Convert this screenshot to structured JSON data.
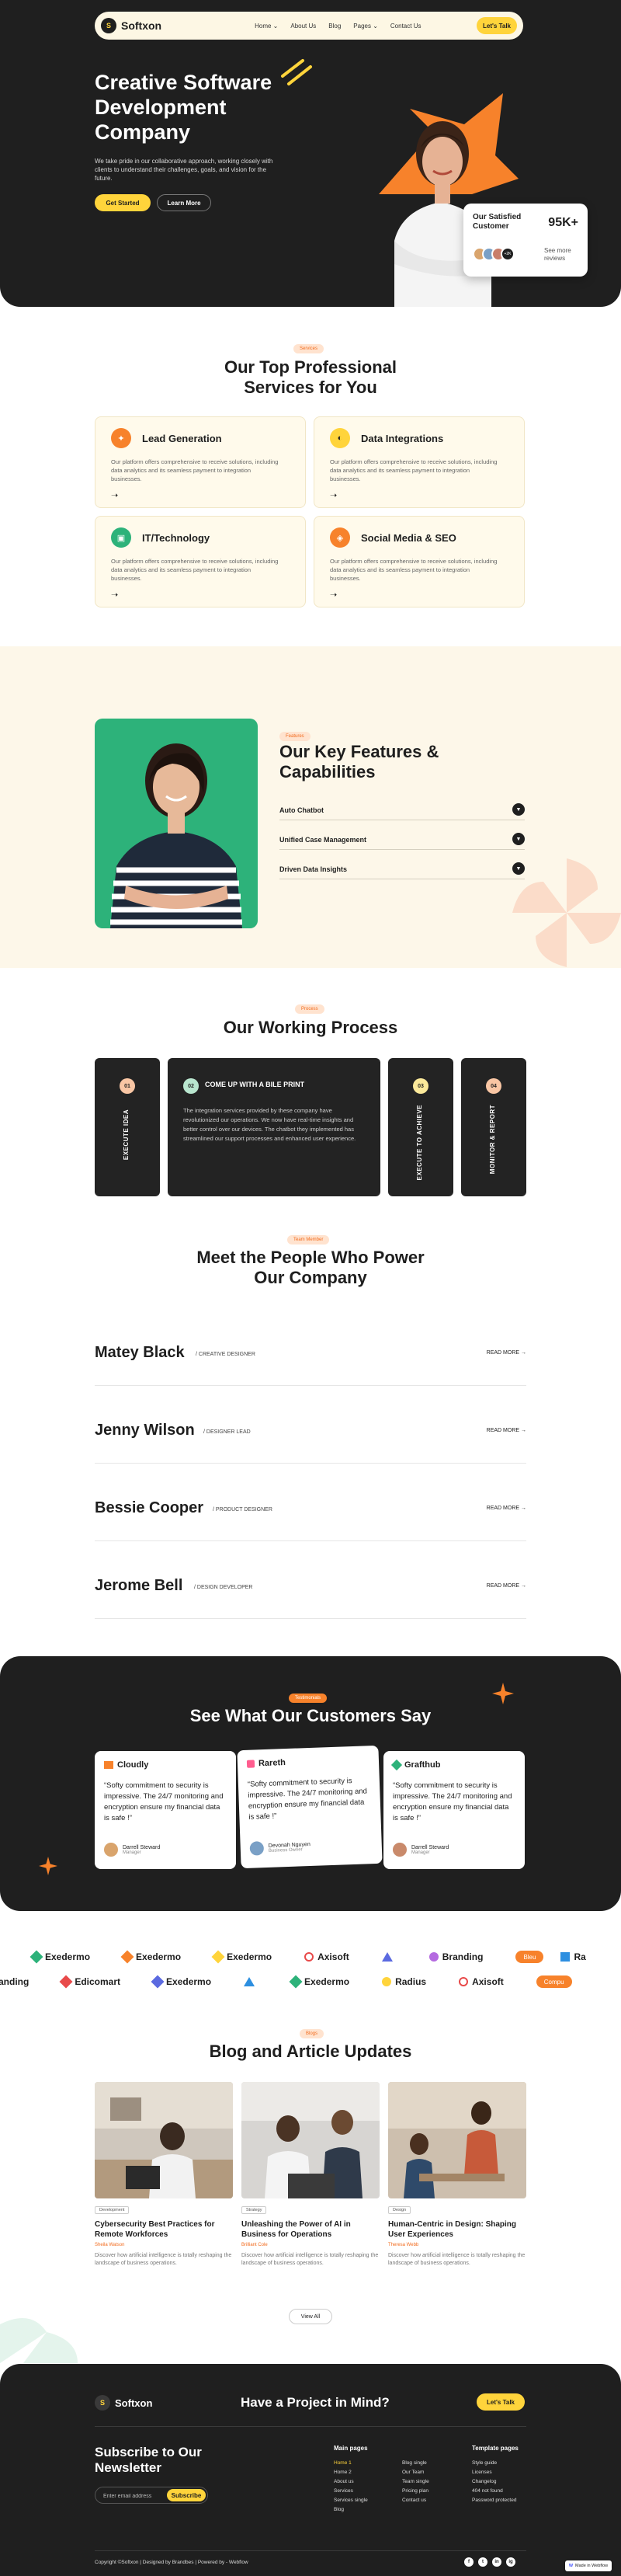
{
  "brand": {
    "name": "Softxon",
    "mark": "S"
  },
  "nav": {
    "links": [
      "Home ⌄",
      "About Us",
      "Blog",
      "Pages ⌄",
      "Contact Us"
    ],
    "cta": "Let's Talk"
  },
  "hero": {
    "title": "Creative Software Development Company",
    "description": "We take pride in our collaborative approach, working closely with clients to understand their challenges, goals, and vision for the future.",
    "primary_button": "Get Started",
    "secondary_button": "Learn More",
    "satisfied": {
      "title": "Our Satisfied Customer",
      "count": "95K+",
      "see_more": "See more reviews",
      "avatar_badge": "+2K"
    }
  },
  "services": {
    "pill": "Services",
    "title": "Our Top Professional Services for You",
    "items": [
      {
        "name": "Lead Generation",
        "desc": "Our platform offers comprehensive to receive solutions, including data analytics and its seamless payment to integration businesses.",
        "color": "#f7822b"
      },
      {
        "name": "Data Integrations",
        "desc": "Our platform offers comprehensive to receive solutions, including data analytics and its seamless payment to integration businesses.",
        "color": "#ffd43b"
      },
      {
        "name": "IT/Technology",
        "desc": "Our platform offers comprehensive to receive solutions, including data analytics and its seamless payment to integration businesses.",
        "color": "#2db27a"
      },
      {
        "name": "Social Media & SEO",
        "desc": "Our platform offers comprehensive to receive solutions, including data analytics and its seamless payment to integration businesses.",
        "color": "#f7822b"
      }
    ]
  },
  "features": {
    "pill": "Features",
    "title": "Our Key Features & Capabilities",
    "items": [
      "Auto Chatbot",
      "Unified Case Management",
      "Driven Data Insights"
    ]
  },
  "process": {
    "pill": "Process",
    "title": "Our Working Process",
    "steps": [
      {
        "num": "01",
        "label": "EXECUTE IDEA",
        "color": "#f9c6a4"
      },
      {
        "num": "02",
        "label": "COME UP WITH A BILE PRINT",
        "color": "#b9e6cf"
      },
      {
        "num": "03",
        "label": "EXECUTE TO ACHIEVE",
        "color": "#fbe99a"
      },
      {
        "num": "04",
        "label": "MONITOR & REPORT",
        "color": "#f9c6a4"
      }
    ],
    "description": "The integration services provided by these company have revolutionized our operations. We now have real-time insights and better control over our devices. The chatbot they implemented has streamlined our support processes and enhanced user experience."
  },
  "team": {
    "pill": "Team Member",
    "title": "Meet the People Who Power Our Company",
    "read_more": "READ MORE →",
    "members": [
      {
        "name": "Matey Black",
        "role": "/ CREATIVE DESIGNER"
      },
      {
        "name": "Jenny Wilson",
        "role": "/ DESIGNER LEAD"
      },
      {
        "name": "Bessie Cooper",
        "role": "/ PRODUCT DESIGNER"
      },
      {
        "name": "Jerome Bell",
        "role": "/ DESIGN DEVELOPER"
      }
    ]
  },
  "testimonials": {
    "pill": "Testimonials",
    "title": "See What Our Customers Say",
    "items": [
      {
        "brand": "Cloudly",
        "quote": "“Softy commitment to security is impressive. The 24/7 monitoring and encryption ensure my financial data is safe !”",
        "name": "Darrell Steward",
        "role": "Manager"
      },
      {
        "brand": "Rareth",
        "quote": "“Softy commitment to security is impressive. The 24/7 monitoring and encryption ensure my financial data is safe !”",
        "name": "Devonah Nguyen",
        "role": "Business Owner"
      },
      {
        "brand": "Grafthub",
        "quote": "“Softy commitment to security is impressive. The 24/7 monitoring and encryption ensure my financial data is safe !”",
        "name": "Darrell Steward",
        "role": "Manager"
      }
    ]
  },
  "logos": {
    "row1": [
      "Exedermo",
      "Exedermo",
      "Exedermo",
      "Axisoft",
      "",
      "Branding",
      "Bleu",
      "Ra"
    ],
    "row2": [
      "anding",
      "Edicomart",
      "Exedermo",
      "",
      "Exedermo",
      "Radius",
      "Axisoft",
      "Compu"
    ]
  },
  "blog": {
    "pill": "Blogs",
    "title": "Blog and Article Updates",
    "view_all": "View All",
    "posts": [
      {
        "tag": "Development",
        "title": "Cybersecurity Best Practices for Remote Workforces",
        "author": "Sheila Watson",
        "desc": "Discover how artificial intelligence is totally reshaping the landscape of business operations."
      },
      {
        "tag": "Strategy",
        "title": "Unleashing the Power of AI in Business for Operations",
        "author": "Brilliant Cole",
        "desc": "Discover how artificial intelligence is totally reshaping the landscape of business operations."
      },
      {
        "tag": "Design",
        "title": "Human-Centric in Design: Shaping User Experiences",
        "author": "Theresa Webb",
        "desc": "Discover how artificial intelligence is totally reshaping the landscape of business operations."
      }
    ]
  },
  "footer": {
    "project": "Have a Project in Mind?",
    "cta": "Let's Talk",
    "newsletter": "Subscribe to Our Newsletter",
    "email_placeholder": "Enter email address",
    "subscribe": "Subscribe",
    "main_pages_title": "Main pages",
    "main_col1": [
      "Home 1",
      "Home 2",
      "About us",
      "Services",
      "Services single",
      "Blog"
    ],
    "main_col2": [
      "Blog single",
      "Our Team",
      "Team single",
      "Pricing plan",
      "Contact us"
    ],
    "template_title": "Template pages",
    "template_col": [
      "Style guide",
      "Licenses",
      "Changelog",
      "404 not found",
      "Password protected"
    ],
    "copyright": "Copyright ©Softxon | Designed by Brandbes | Powered by - Webflow",
    "social": [
      "f",
      "t",
      "in",
      "ig"
    ],
    "made_in_webflow": "Made in Webflow"
  },
  "colors": {
    "dark": "#1f1f1f",
    "accent": "#ffd43b",
    "orange": "#f7822b",
    "green": "#2db27a",
    "cream": "#fdf7e9"
  }
}
